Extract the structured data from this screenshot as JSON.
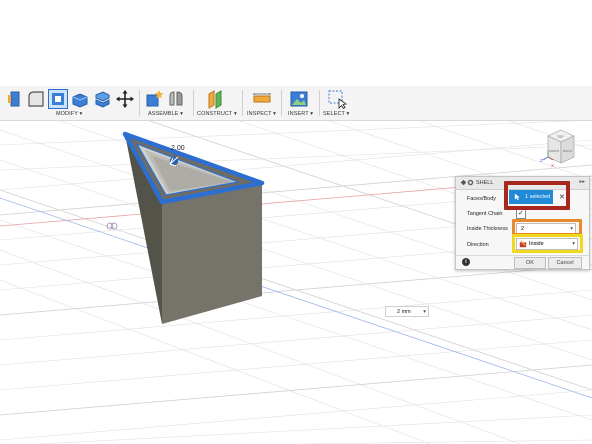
{
  "toolbar": {
    "groups": [
      {
        "label": "MODIFY"
      },
      {
        "label": "ASSEMBLE"
      },
      {
        "label": "CONSTRUCT"
      },
      {
        "label": "INSPECT"
      },
      {
        "label": "INSERT"
      },
      {
        "label": "SELECT"
      }
    ],
    "dropdown_glyph": "▾"
  },
  "viewport": {
    "dimension_label": "2.00",
    "viewcube_labels": [
      "TOP",
      "FRONT",
      "RIGHT"
    ],
    "axis_labels": [
      "Z",
      "X"
    ]
  },
  "shell_dialog": {
    "title": "SHELL",
    "faces_body_label": "Faces/Body",
    "selection_button": "1 selected",
    "clear_glyph": "✕",
    "tangent_chain_label": "Tangent Chain",
    "tangent_chain_checked": true,
    "check_glyph": "✓",
    "inside_thickness_label": "Inside Thickness",
    "inside_thickness_value": "2",
    "direction_label": "Direction",
    "direction_value": "Inside",
    "ok_label": "OK",
    "cancel_label": "Cancel",
    "info_glyph": "i",
    "expand_glyph": "▸▸"
  },
  "dimension_input": {
    "value": "2 mm"
  },
  "colors": {
    "selection_blue": "#2d6fd1",
    "button_blue": "#1f8ad6",
    "highlight_red": "#a5271e",
    "highlight_orange": "#e88a2c",
    "highlight_yellow": "#f0d81c",
    "body_gray": "#6f6d63"
  }
}
